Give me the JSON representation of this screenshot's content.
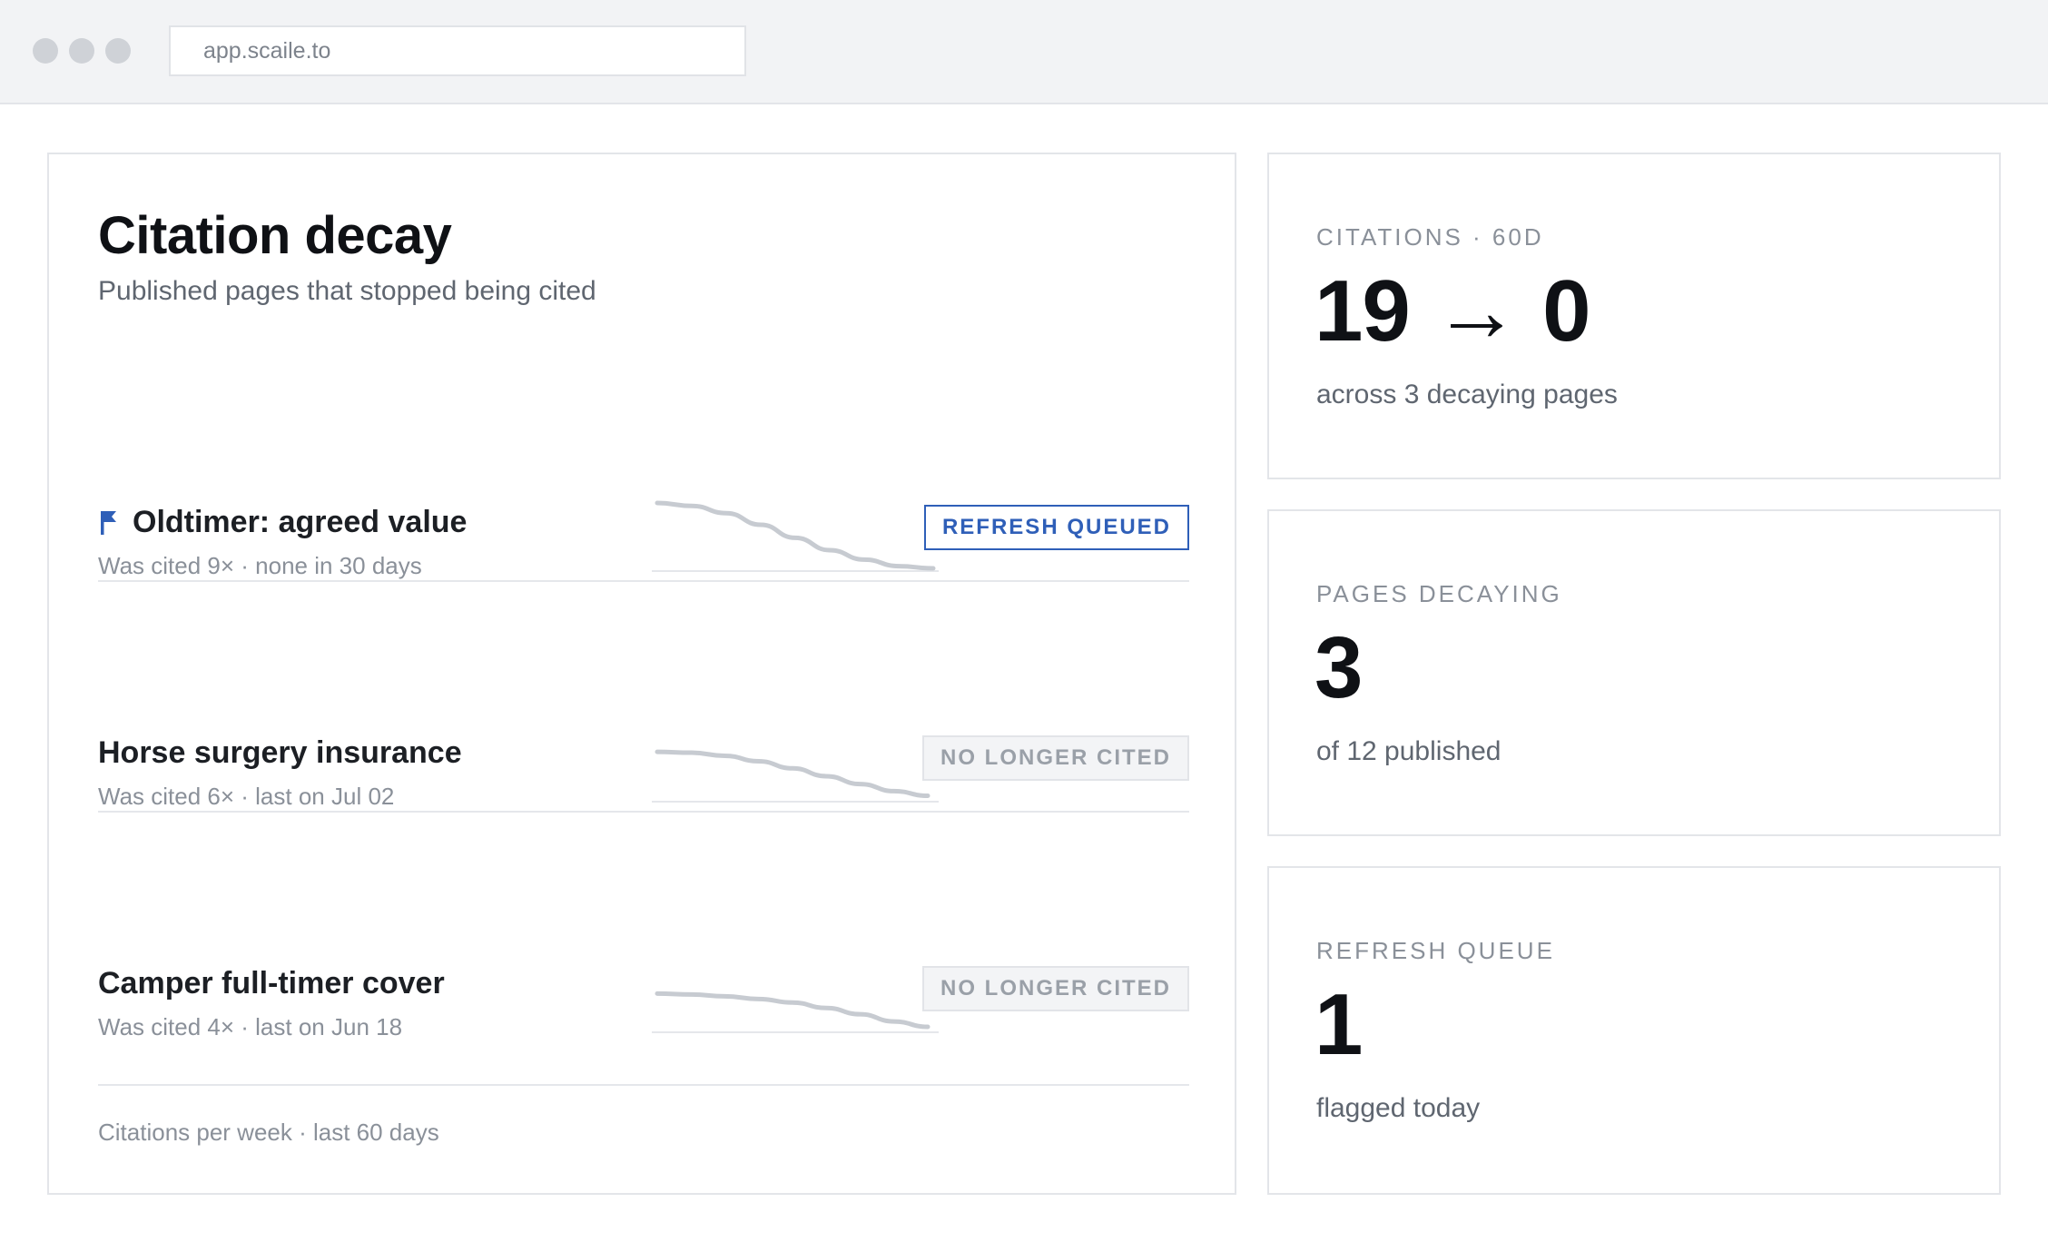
{
  "browser": {
    "url": "app.scaile.to"
  },
  "panel": {
    "title": "Citation decay",
    "subtitle": "Published pages that stopped being cited",
    "footer": "Citations per week · last 60 days",
    "rows": [
      {
        "title": "Oldtimer: agreed value",
        "meta": "Was cited 9× · none in 30 days",
        "badge": "REFRESH QUEUED",
        "flagged": true,
        "trend": [
          9,
          8.6,
          7.6,
          6,
          4.2,
          2.5,
          1.2,
          0.3,
          0
        ]
      },
      {
        "title": "Horse surgery insurance",
        "meta": "Was cited 6× · last on Jul 02",
        "badge": "NO LONGER CITED",
        "flagged": false,
        "trend": [
          6,
          5.9,
          5.5,
          4.8,
          3.9,
          2.9,
          1.9,
          1.0,
          0.4
        ]
      },
      {
        "title": "Camper full-timer cover",
        "meta": "Was cited 4× · last on Jun 18",
        "badge": "NO LONGER CITED",
        "flagged": false,
        "trend": [
          4,
          3.9,
          3.7,
          3.4,
          3.0,
          2.4,
          1.7,
          0.9,
          0.3
        ]
      }
    ]
  },
  "stats": [
    {
      "label": "CITATIONS · 60D",
      "value": "19 → 0",
      "desc": "across 3 decaying pages"
    },
    {
      "label": "PAGES DECAYING",
      "value": "3",
      "desc": "of 12 published"
    },
    {
      "label": "REFRESH QUEUE",
      "value": "1",
      "desc": "flagged today"
    }
  ],
  "colors": {
    "accent": "#2f5fb8",
    "sparkline": "#c7cbd1",
    "muted_badge_bg": "#f3f4f6"
  },
  "icons": {
    "flag": "flag-icon"
  }
}
